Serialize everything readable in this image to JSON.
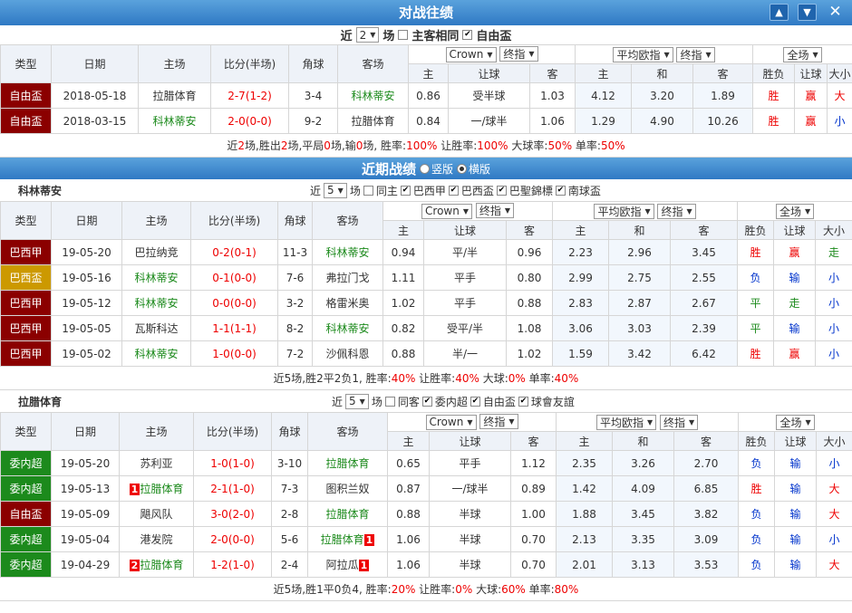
{
  "colors": {
    "header": "#2f79c4",
    "cup": "#8b0000",
    "league": "#8b0000",
    "bx_cup": "#cc9900",
    "wx_league": "#1c8a1c"
  },
  "header": {
    "title": "对战往绩",
    "btn_up": "▲",
    "btn_down": "▼",
    "btn_close": "✕"
  },
  "h2h": {
    "near": "近",
    "count": "2",
    "chang": "场",
    "same": "主客相同",
    "free": "自由盃",
    "cols": {
      "type": "类型",
      "date": "日期",
      "home": "主场",
      "score": "比分(半场)",
      "corner": "角球",
      "away": "客场",
      "company": "Crown",
      "kind": "终指",
      "avg": "平均欧指",
      "kind2": "终指",
      "scope": "全场",
      "zhu": "主",
      "rq": "让球",
      "ke": "客",
      "zhu2": "主",
      "he": "和",
      "ke2": "客",
      "sf": "胜负",
      "rqr": "让球",
      "dx": "大小"
    },
    "rows": [
      {
        "type": "自由盃",
        "date": "2018-05-18",
        "home": "拉腊体育",
        "score": "2-7(1-2)",
        "corner": "3-4",
        "away": "科林蒂安",
        "z": "0.86",
        "rq": "受半球",
        "k": "1.03",
        "ez": "4.12",
        "eh": "3.20",
        "ek": "1.89",
        "sf": "胜",
        "rr": "赢",
        "dx": "大"
      },
      {
        "type": "自由盃",
        "date": "2018-03-15",
        "home": "科林蒂安",
        "score": "2-0(0-0)",
        "corner": "9-2",
        "away": "拉腊体育",
        "z": "0.84",
        "rq": "一/球半",
        "k": "1.06",
        "ez": "1.29",
        "eh": "4.90",
        "ek": "10.26",
        "sf": "胜",
        "rr": "赢",
        "dx": "小"
      }
    ],
    "summary": {
      "a": "近",
      "n": "2",
      "b": "场,胜出",
      "w": "2",
      "c": "场,平局",
      "d": "0",
      "e": "场,输",
      "l": "0",
      "f": "场, 胜率:",
      "wr": "100%",
      "g": " 让胜率:",
      "rr": "100%",
      "h": " 大球率:",
      "br": "50%",
      "i": " 单率:",
      "sr": "50%"
    }
  },
  "recent": {
    "title": "近期战绩",
    "v": "竖版",
    "h": "横版"
  },
  "t1": {
    "name": "科林蒂安",
    "near": "近",
    "count": "5",
    "chang": "场",
    "same": "同主",
    "f1": "巴西甲",
    "f2": "巴西盃",
    "f3": "巴聖錦標",
    "f4": "南球盃",
    "rows": [
      {
        "type": "巴西甲",
        "date": "19-05-20",
        "home": "巴拉纳竞",
        "score": "0-2(0-1)",
        "corner": "11-3",
        "away": "科林蒂安",
        "z": "0.94",
        "rq": "平/半",
        "k": "0.96",
        "ez": "2.23",
        "eh": "2.96",
        "ek": "3.45",
        "sf": "胜",
        "rr": "赢",
        "dx": "走"
      },
      {
        "type": "巴西盃",
        "date": "19-05-16",
        "home": "科林蒂安",
        "score": "0-1(0-0)",
        "corner": "7-6",
        "away": "弗拉门戈",
        "z": "1.11",
        "rq": "平手",
        "k": "0.80",
        "ez": "2.99",
        "eh": "2.75",
        "ek": "2.55",
        "sf": "负",
        "rr": "输",
        "dx": "小"
      },
      {
        "type": "巴西甲",
        "date": "19-05-12",
        "home": "科林蒂安",
        "score": "0-0(0-0)",
        "corner": "3-2",
        "away": "格雷米奥",
        "z": "1.02",
        "rq": "平手",
        "k": "0.88",
        "ez": "2.83",
        "eh": "2.87",
        "ek": "2.67",
        "sf": "平",
        "rr": "走",
        "dx": "小"
      },
      {
        "type": "巴西甲",
        "date": "19-05-05",
        "home": "瓦斯科达",
        "score": "1-1(1-1)",
        "corner": "8-2",
        "away": "科林蒂安",
        "z": "0.82",
        "rq": "受平/半",
        "k": "1.08",
        "ez": "3.06",
        "eh": "3.03",
        "ek": "2.39",
        "sf": "平",
        "rr": "输",
        "dx": "小"
      },
      {
        "type": "巴西甲",
        "date": "19-05-02",
        "home": "科林蒂安",
        "score": "1-0(0-0)",
        "corner": "7-2",
        "away": "沙佩科恩",
        "z": "0.88",
        "rq": "半/一",
        "k": "1.02",
        "ez": "1.59",
        "eh": "3.42",
        "ek": "6.42",
        "sf": "胜",
        "rr": "赢",
        "dx": "小"
      }
    ],
    "summary": {
      "a": "近5场,胜2平2负1, 胜率:",
      "wr": "40%",
      "b": " 让胜率:",
      "rr": "40%",
      "c": " 大球:",
      "br": "0%",
      "d": " 单率:",
      "sr": "40%"
    }
  },
  "t2": {
    "name": "拉腊体育",
    "near": "近",
    "count": "5",
    "chang": "场",
    "same": "同客",
    "f1": "委内超",
    "f2": "自由盃",
    "f3": "球會友誼",
    "rows": [
      {
        "type": "委内超",
        "date": "19-05-20",
        "home": "苏利亚",
        "score": "1-0(1-0)",
        "corner": "3-10",
        "away": "拉腊体育",
        "z": "0.65",
        "rq": "平手",
        "k": "1.12",
        "ez": "2.35",
        "eh": "3.26",
        "ek": "2.70",
        "sf": "负",
        "rr": "输",
        "dx": "小",
        "hr": "",
        "ar": ""
      },
      {
        "type": "委内超",
        "date": "19-05-13",
        "home": "拉腊体育",
        "score": "2-1(1-0)",
        "corner": "7-3",
        "away": "图积兰奴",
        "z": "0.87",
        "rq": "一/球半",
        "k": "0.89",
        "ez": "1.42",
        "eh": "4.09",
        "ek": "6.85",
        "sf": "胜",
        "rr": "输",
        "dx": "大",
        "hr": "1",
        "ar": ""
      },
      {
        "type": "自由盃",
        "date": "19-05-09",
        "home": "飓风队",
        "score": "3-0(2-0)",
        "corner": "2-8",
        "away": "拉腊体育",
        "z": "0.88",
        "rq": "半球",
        "k": "1.00",
        "ez": "1.88",
        "eh": "3.45",
        "ek": "3.82",
        "sf": "负",
        "rr": "输",
        "dx": "大",
        "hr": "",
        "ar": ""
      },
      {
        "type": "委内超",
        "date": "19-05-04",
        "home": "港发院",
        "score": "2-0(0-0)",
        "corner": "5-6",
        "away": "拉腊体育",
        "z": "1.06",
        "rq": "半球",
        "k": "0.70",
        "ez": "2.13",
        "eh": "3.35",
        "ek": "3.09",
        "sf": "负",
        "rr": "输",
        "dx": "小",
        "hr": "",
        "ar": "1"
      },
      {
        "type": "委内超",
        "date": "19-04-29",
        "home": "拉腊体育",
        "score": "1-2(1-0)",
        "corner": "2-4",
        "away": "阿拉瓜",
        "z": "1.06",
        "rq": "半球",
        "k": "0.70",
        "ez": "2.01",
        "eh": "3.13",
        "ek": "3.53",
        "sf": "负",
        "rr": "输",
        "dx": "大",
        "hr": "2",
        "ar": "1"
      }
    ],
    "summary": {
      "a": "近5场,胜1平0负4, 胜率:",
      "wr": "20%",
      "b": " 让胜率:",
      "rr": "0%",
      "c": " 大球:",
      "br": "60%",
      "d": " 单率:",
      "sr": "80%"
    }
  }
}
